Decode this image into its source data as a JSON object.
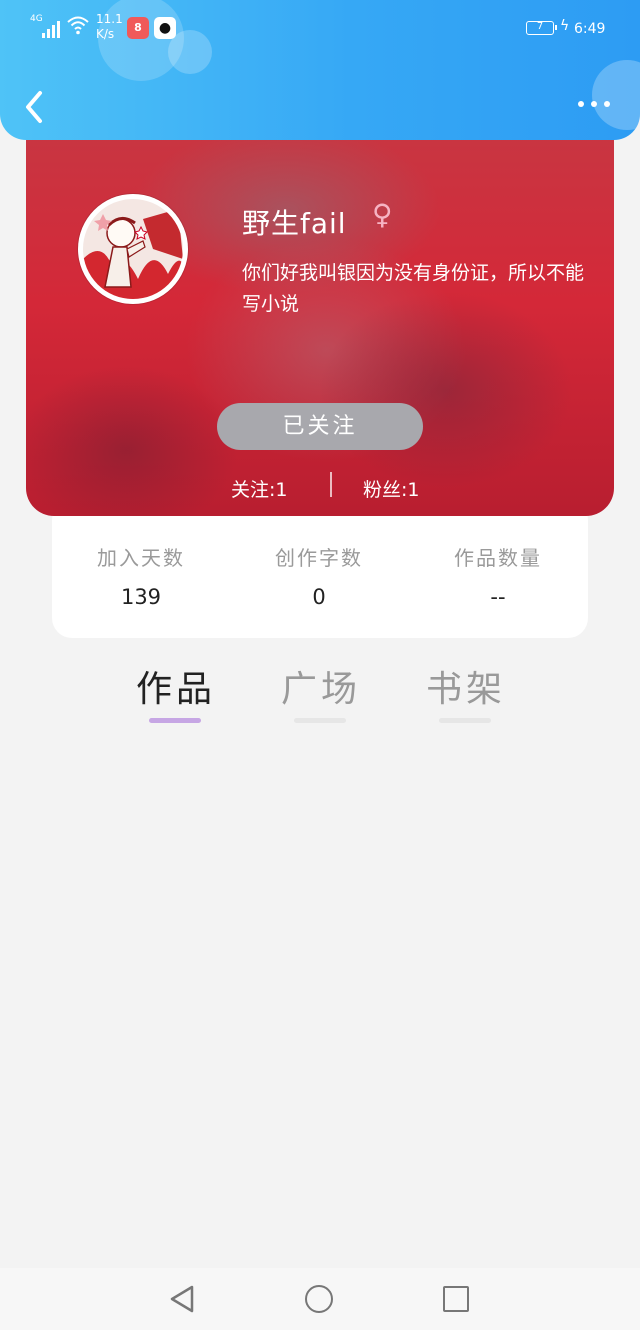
{
  "status_bar": {
    "network": "4G",
    "speed_value": "11.1",
    "speed_unit": "K/s",
    "app1_icon": "8",
    "battery": "7",
    "time": "6:49"
  },
  "header": {
    "back_icon": "chevron-left-icon",
    "more_icon": "more-horizontal-icon"
  },
  "profile": {
    "nickname": "野生fail",
    "gender_symbol": "♀",
    "bio": "你们好我叫银因为没有身份证，所以不能写小说",
    "follow_button": "已关注",
    "following": "关注:1",
    "followers": "粉丝:1"
  },
  "stats": [
    {
      "label": "加入天数",
      "value": "139"
    },
    {
      "label": "创作字数",
      "value": "0"
    },
    {
      "label": "作品数量",
      "value": "--"
    }
  ],
  "tabs": [
    {
      "label": "作品",
      "active": true
    },
    {
      "label": "广场",
      "active": false
    },
    {
      "label": "书架",
      "active": false
    }
  ],
  "colors": {
    "header_blue": "#36a8f5",
    "profile_red": "#d42838",
    "active_tab_underline": "#c6a6e4"
  }
}
